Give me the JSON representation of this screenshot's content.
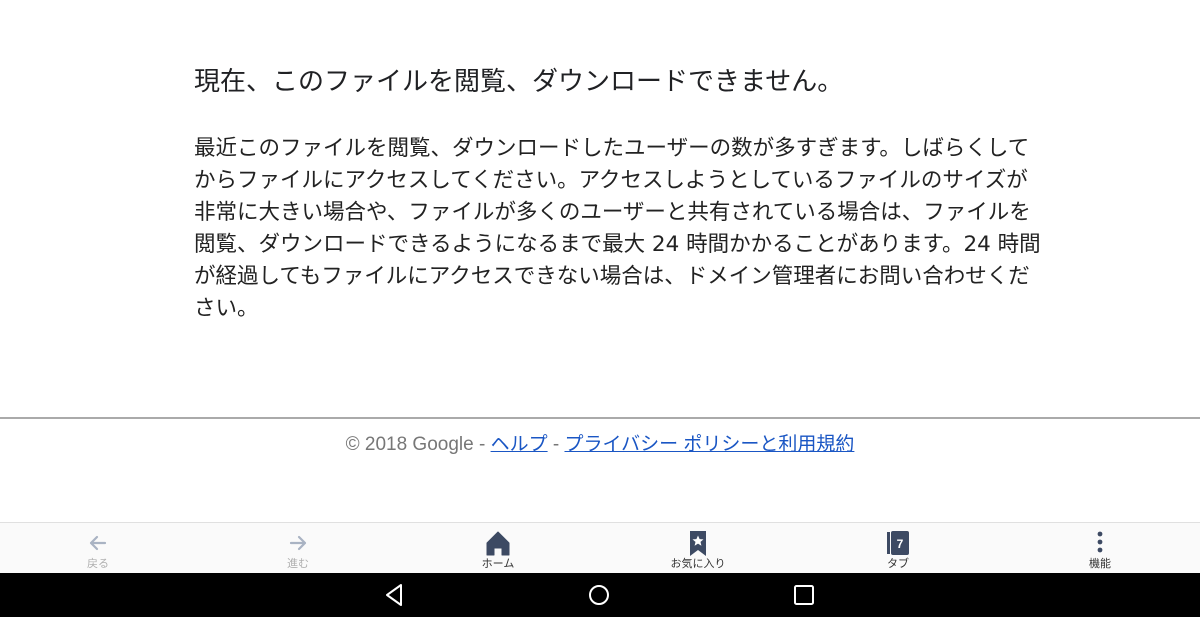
{
  "error_page": {
    "heading": "現在、このファイルを閲覧、ダウンロードできません。",
    "message": "最近このファイルを閲覧、ダウンロードしたユーザーの数が多すぎます。しばらくしてからファイルにアクセスしてください。アクセスしようとしているファイルのサイズが非常に大きい場合や、ファイルが多くのユーザーと共有されている場合は、ファイルを閲覧、ダウンロードできるようになるまで最大 24 時間かかることがあります。24 時間が経過してもファイルにアクセスできない場合は、ドメイン管理者にお問い合わせください。"
  },
  "footer": {
    "copyright": "© 2018 Google",
    "separator": " - ",
    "help_link": "ヘルプ",
    "privacy_link": "プライバシー ポリシーと利用規約"
  },
  "browser_toolbar": {
    "back_label": "戻る",
    "forward_label": "進む",
    "home_label": "ホーム",
    "bookmarks_label": "お気に入り",
    "tabs_label": "タブ",
    "tab_count": "7",
    "menu_label": "機能"
  },
  "icons": {
    "back": "arrow-left-icon",
    "forward": "arrow-right-icon",
    "home": "home-icon",
    "bookmarks": "bookmark-star-icon",
    "tabs": "tabs-icon",
    "menu": "more-vert-icon",
    "nav_back": "triangle-back-icon",
    "nav_home": "circle-home-icon",
    "nav_recents": "square-recents-icon"
  },
  "colors": {
    "link": "#1a56c4",
    "toolbar_icon_active": "#3d4a63",
    "toolbar_icon_disabled": "#a9b3c3",
    "system_nav_bg": "#000000"
  }
}
